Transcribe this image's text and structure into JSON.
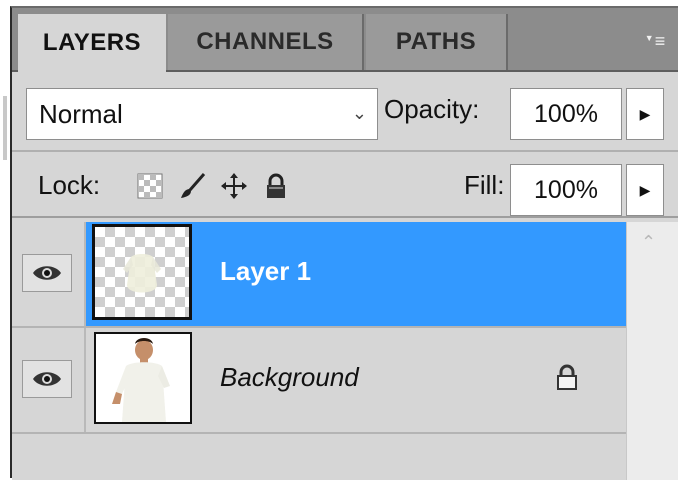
{
  "tabs": [
    {
      "label": "LAYERS",
      "active": true
    },
    {
      "label": "CHANNELS",
      "active": false
    },
    {
      "label": "PATHS",
      "active": false
    }
  ],
  "panel_menu_icon": "panel-menu-icon",
  "blend_mode": {
    "value": "Normal"
  },
  "opacity": {
    "label": "Opacity:",
    "value": "100%"
  },
  "lock": {
    "label": "Lock:",
    "icons": [
      "lock-transparent-pixels-icon",
      "lock-image-pixels-icon",
      "lock-position-icon",
      "lock-all-icon"
    ]
  },
  "fill": {
    "label": "Fill:",
    "value": "100%"
  },
  "layers": [
    {
      "name": "Layer 1",
      "selected": true,
      "visible": true
    },
    {
      "name": "Background",
      "selected": false,
      "visible": true,
      "locked": true
    }
  ],
  "colors": {
    "selection": "#3399ff",
    "panel": "#d6d6d6",
    "tabbar": "#8c8c8c"
  }
}
